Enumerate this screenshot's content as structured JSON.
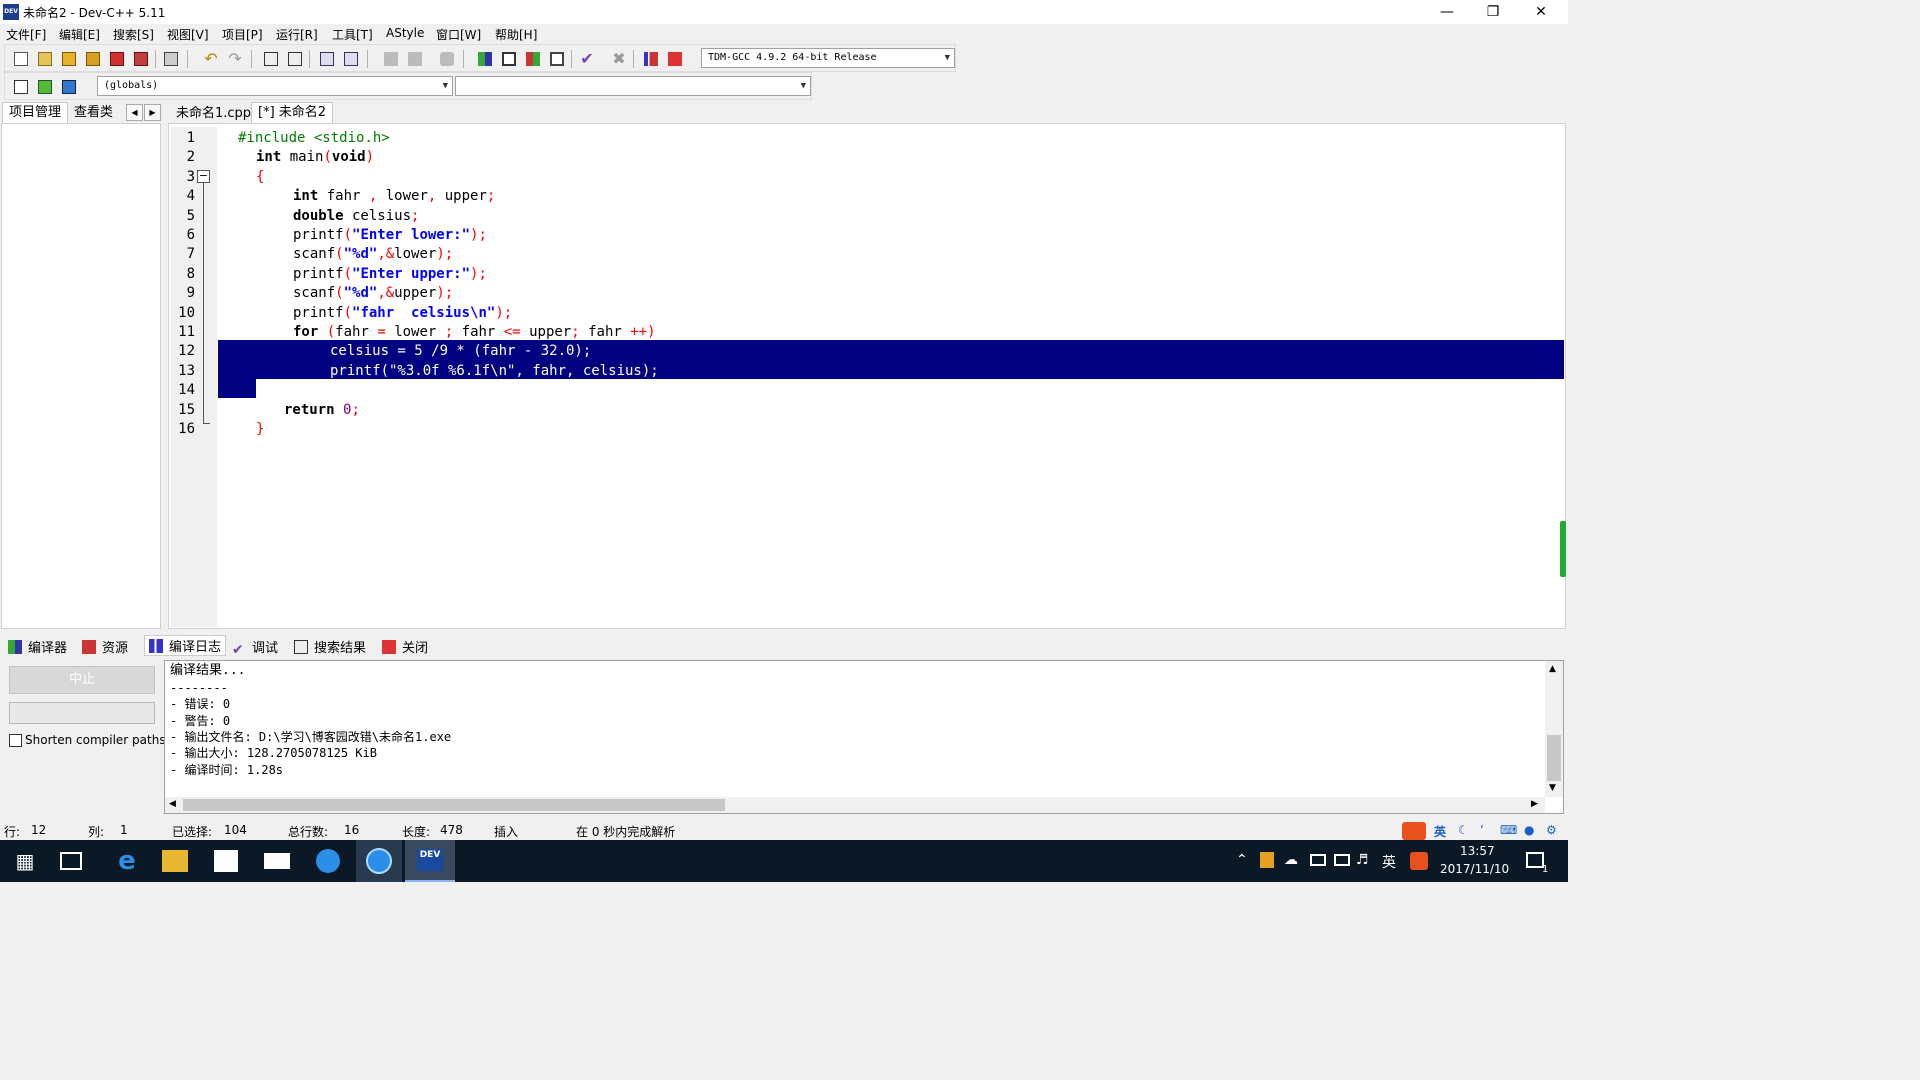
{
  "window": {
    "title": "未命名2 - Dev-C++ 5.11",
    "icon_label": "DEV"
  },
  "menu": [
    "文件[F]",
    "编辑[E]",
    "搜索[S]",
    "视图[V]",
    "项目[P]",
    "运行[R]",
    "工具[T]",
    "AStyle",
    "窗口[W]",
    "帮助[H]"
  ],
  "toolbar": {
    "compiler": "TDM-GCC 4.9.2 64-bit Release",
    "scope": "(globals)",
    "symbol": ""
  },
  "left_tabs": [
    "项目管理",
    "查看类"
  ],
  "file_tabs": [
    "未命名1.cpp",
    "[*] 未命名2"
  ],
  "code": {
    "line_numbers": [
      "1",
      "2",
      "3",
      "4",
      "5",
      "6",
      "7",
      "8",
      "9",
      "10",
      "11",
      "12",
      "13",
      "14",
      "15",
      "16"
    ],
    "lines": [
      "#include <stdio.h>",
      "int main(void)",
      "{",
      "int fahr , lower, upper;",
      "double celsius;",
      "printf(\"Enter lower:\");",
      "scanf(\"%d\",&lower);",
      "printf(\"Enter upper:\");",
      "scanf(\"%d\",&upper);",
      "printf(\"fahr  celsius\\n\");",
      "for (fahr = lower ; fahr <= upper; fahr ++)",
      "celsius = 5 /9 * (fahr - 32.0);",
      "printf(\"%3.0f %6.1f\\n\", fahr, celsius);",
      "",
      "return 0;",
      "}"
    ]
  },
  "bottom_tabs": [
    "编译器",
    "资源",
    "编译日志",
    "调试",
    "搜索结果",
    "关闭"
  ],
  "log_panel": {
    "abort_button": "中止",
    "shorten_label": "Shorten compiler paths",
    "lines": [
      "编译结果...",
      "--------",
      "- 错误: 0",
      "- 警告: 0",
      "- 输出文件名: D:\\学习\\博客园改错\\未命名1.exe",
      "- 输出大小: 128.2705078125 KiB",
      "- 编译时间: 1.28s"
    ]
  },
  "status": {
    "row_label": "行:",
    "row": "12",
    "col_label": "列:",
    "col": "1",
    "selected_label": "已选择:",
    "selected": "104",
    "total_label": "总行数:",
    "total": "16",
    "length_label": "长度:",
    "length": "478",
    "mode": "插入",
    "parse": "在 0 秒内完成解析"
  },
  "ime": {
    "lang": "英"
  },
  "taskbar": {
    "time": "13:57",
    "date": "2017/11/10",
    "lang": "英",
    "notif_count": "1",
    "dev_label": "DEV"
  },
  "colors": {
    "selection": "#000080",
    "keyword": "#000000",
    "string": "#0000ff",
    "symbol": "#ff0000",
    "preprocessor": "#008000",
    "number": "#800080"
  }
}
